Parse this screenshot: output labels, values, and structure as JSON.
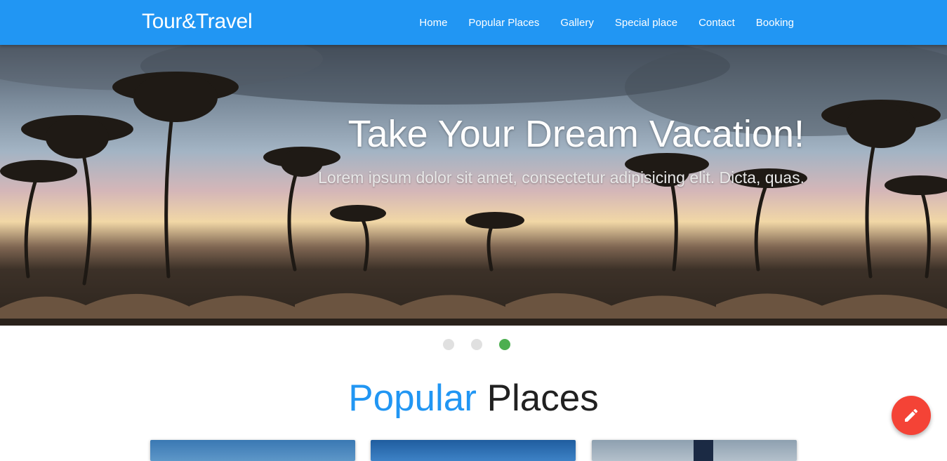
{
  "header": {
    "brand": "Tour&Travel",
    "nav": [
      {
        "label": "Home"
      },
      {
        "label": "Popular Places"
      },
      {
        "label": "Gallery"
      },
      {
        "label": "Special place"
      },
      {
        "label": "Contact"
      },
      {
        "label": "Booking"
      }
    ]
  },
  "hero": {
    "title": "Take Your Dream Vacation!",
    "subtitle": "Lorem ipsum dolor sit amet, consectetur adipisicing elit. Dicta, quas."
  },
  "carousel": {
    "slides": 3,
    "active_index": 2,
    "active_color": "#4caf50",
    "inactive_color": "#e0e0e0"
  },
  "section": {
    "title_accent": "Popular",
    "title_rest": "Places"
  },
  "fab": {
    "icon": "pencil-icon",
    "color": "#f44336"
  },
  "colors": {
    "primary": "#2196f3"
  }
}
